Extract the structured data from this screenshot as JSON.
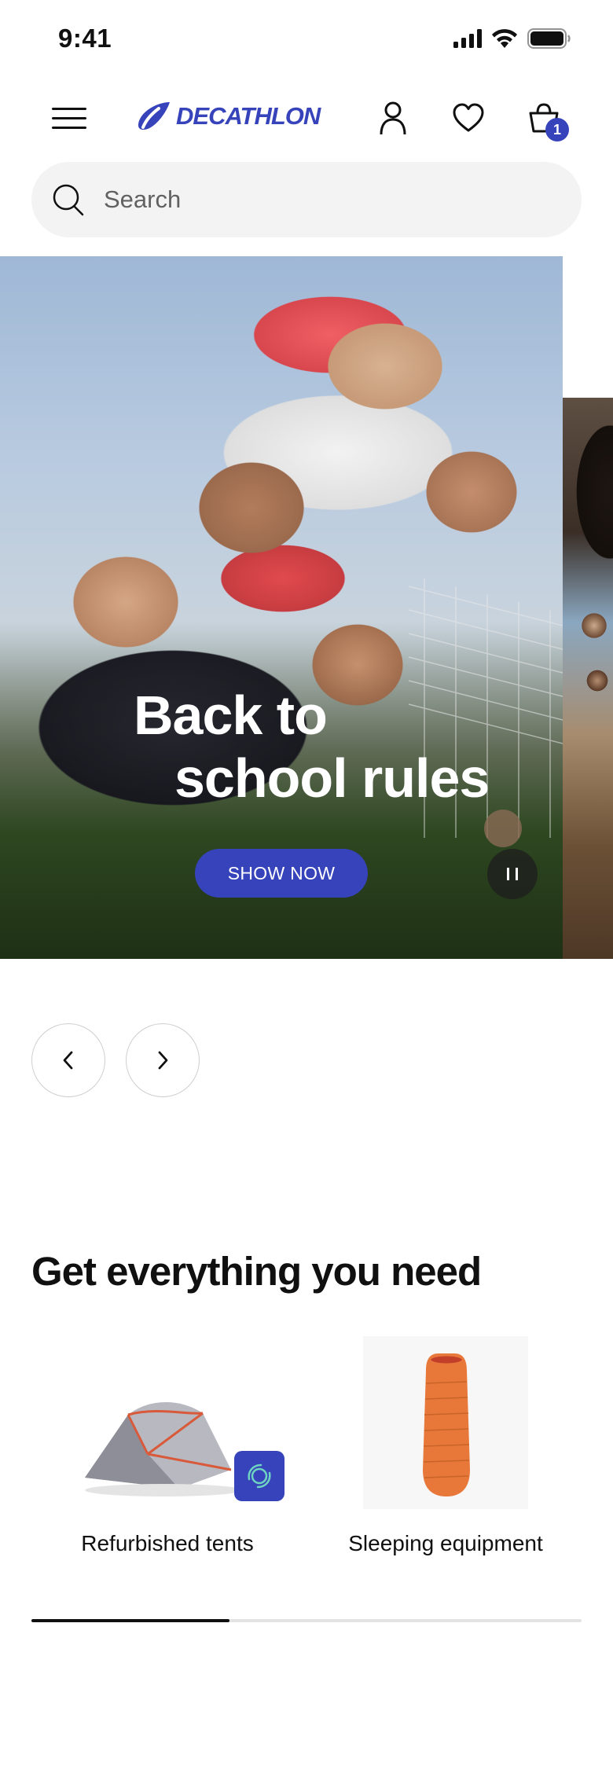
{
  "status_bar": {
    "time": "9:41"
  },
  "header": {
    "logo_text": "DECATHLON",
    "cart_count": "1"
  },
  "search": {
    "placeholder": "Search"
  },
  "hero": {
    "title_line1": "Back to",
    "title_line2": "school rules",
    "cta_label": "SHOW NOW"
  },
  "section": {
    "title": "Get everything you need",
    "categories": [
      {
        "label": "Refurbished tents",
        "icon": "tent-icon",
        "badge_icon": "refurbished-icon"
      },
      {
        "label": "Sleeping equipment",
        "icon": "sleeping-bag-icon"
      }
    ],
    "scroll_progress": 0.36
  },
  "colors": {
    "brand": "#3643BA",
    "text": "#101010",
    "search_bg": "#f3f3f3"
  }
}
